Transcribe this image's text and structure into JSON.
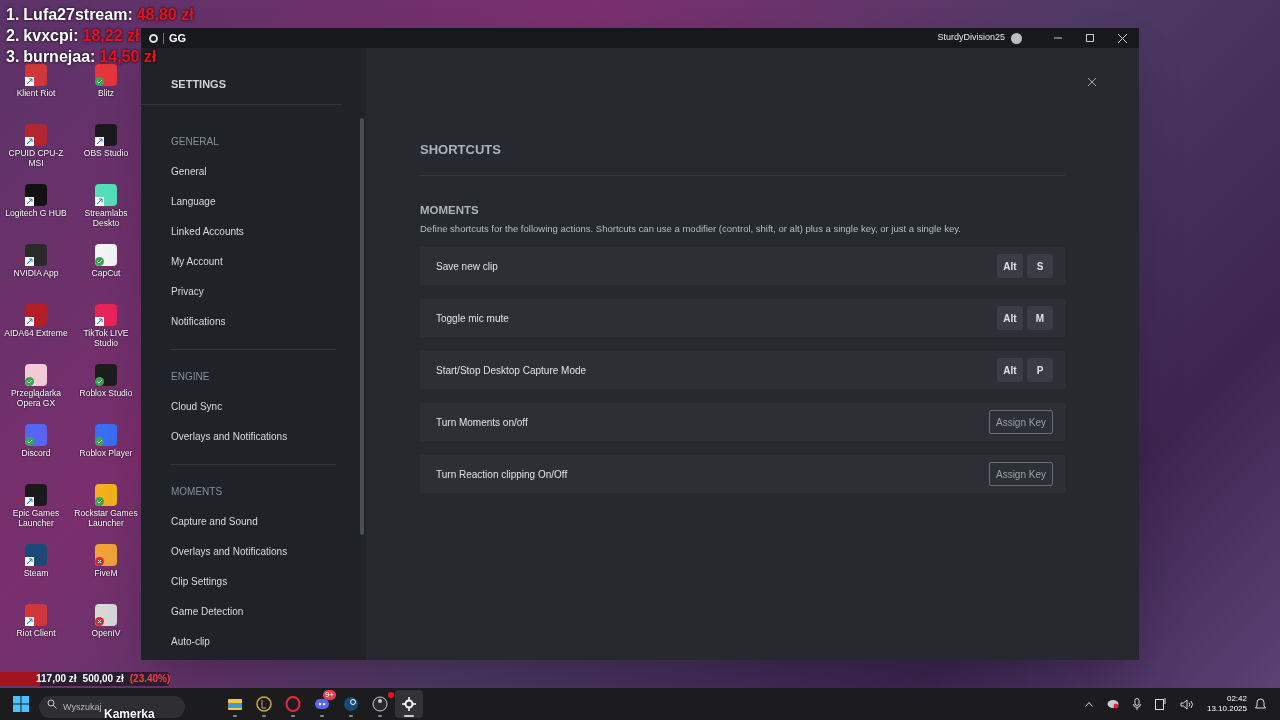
{
  "overlay": {
    "leaderboard": [
      {
        "rank": "1.",
        "name": "Lufa27stream:",
        "amount": "48,80 zł"
      },
      {
        "rank": "2.",
        "name": "kvxcpi:",
        "amount": "18,22 zł"
      },
      {
        "rank": "3.",
        "name": "burnejaa:",
        "amount": "14,50 zł"
      }
    ],
    "goal": {
      "current": "117,00 zł",
      "target": "500,00 zł",
      "percent": "(23.40%)",
      "level": 0.234
    },
    "camera_label": "Kamerka"
  },
  "desktop_icons": [
    {
      "label": "Klient Riot",
      "color": "#d13639",
      "kind": "shortcut"
    },
    {
      "label": "Blitz",
      "color": "#e8343f",
      "kind": "synced"
    },
    {
      "label": "CPUID CPU-Z MSI",
      "color": "#b3262f",
      "kind": "shortcut"
    },
    {
      "label": "OBS Studio",
      "color": "#1b1b1f",
      "kind": "shortcut"
    },
    {
      "label": "Logitech G HUB",
      "color": "#111111",
      "kind": "shortcut"
    },
    {
      "label": "Streamlabs Deskto",
      "color": "#53e0b8",
      "kind": "shortcut"
    },
    {
      "label": "NVIDIA App",
      "color": "#2a2a2a",
      "kind": "shortcut"
    },
    {
      "label": "CapCut",
      "color": "#f4f4f4",
      "kind": "synced"
    },
    {
      "label": "AIDA64 Extreme",
      "color": "#b51d24",
      "kind": "shortcut"
    },
    {
      "label": "TikTok LIVE Studio",
      "color": "#e8255a",
      "kind": "shortcut"
    },
    {
      "label": "Przeglądarka Opera GX",
      "color": "#f2c9d6",
      "kind": "synced"
    },
    {
      "label": "Roblox Studio",
      "color": "#1d1d1d",
      "kind": "synced"
    },
    {
      "label": "Discord",
      "color": "#5865f2",
      "kind": "synced"
    },
    {
      "label": "Roblox Player",
      "color": "#3b6ef5",
      "kind": "synced"
    },
    {
      "label": "Epic Games Launcher",
      "color": "#1a1a1a",
      "kind": "shortcut"
    },
    {
      "label": "Rockstar Games Launcher",
      "color": "#f5b01b",
      "kind": "synced"
    },
    {
      "label": "Steam",
      "color": "#1b4a77",
      "kind": "shortcut"
    },
    {
      "label": "FiveM",
      "color": "#f3a33a",
      "kind": "error"
    },
    {
      "label": "Riot Client",
      "color": "#d13639",
      "kind": "shortcut"
    },
    {
      "label": "OpenIV",
      "color": "#d8d8d8",
      "kind": "error"
    }
  ],
  "window": {
    "title": "GG",
    "user": "SturdyDivision25"
  },
  "sidebar": {
    "title": "SETTINGS",
    "sections": [
      {
        "heading": "GENERAL",
        "items": [
          "General",
          "Language",
          "Linked Accounts",
          "My Account",
          "Privacy",
          "Notifications"
        ]
      },
      {
        "heading": "ENGINE",
        "items": [
          "Cloud Sync",
          "Overlays and Notifications"
        ]
      },
      {
        "heading": "MOMENTS",
        "items": [
          "Capture and Sound",
          "Overlays and Notifications",
          "Clip Settings",
          "Game Detection",
          "Auto-clip"
        ]
      }
    ]
  },
  "content": {
    "title": "SHORTCUTS",
    "section": "MOMENTS",
    "description": "Define shortcuts for the following actions. Shortcuts can use a modifier (control, shift, or alt) plus a single key, or just a single key.",
    "shortcuts": [
      {
        "label": "Save new clip",
        "kind": "keys",
        "keys": [
          "Alt",
          "S"
        ]
      },
      {
        "label": "Toggle mic mute",
        "kind": "keys",
        "keys": [
          "Alt",
          "M"
        ]
      },
      {
        "label": "Start/Stop Desktop Capture Mode",
        "kind": "keys",
        "keys": [
          "Alt",
          "P"
        ]
      },
      {
        "label": "Turn Moments on/off",
        "kind": "assign",
        "button": "Assign Key"
      },
      {
        "label": "Turn Reaction clipping On/Off",
        "kind": "assign",
        "button": "Assign Key"
      }
    ]
  },
  "taskbar": {
    "search_placeholder": "Wyszukaj",
    "apps": [
      {
        "kind": "folder",
        "active": false
      },
      {
        "kind": "league",
        "active": false
      },
      {
        "kind": "opera",
        "active": false
      },
      {
        "kind": "discord",
        "notification_count": "9+",
        "active": false
      },
      {
        "kind": "steam",
        "active": false
      },
      {
        "kind": "obs",
        "unread": true,
        "active": false
      },
      {
        "kind": "steelseries",
        "active": true
      }
    ],
    "time": "02:42",
    "date": "13.10.2025"
  }
}
